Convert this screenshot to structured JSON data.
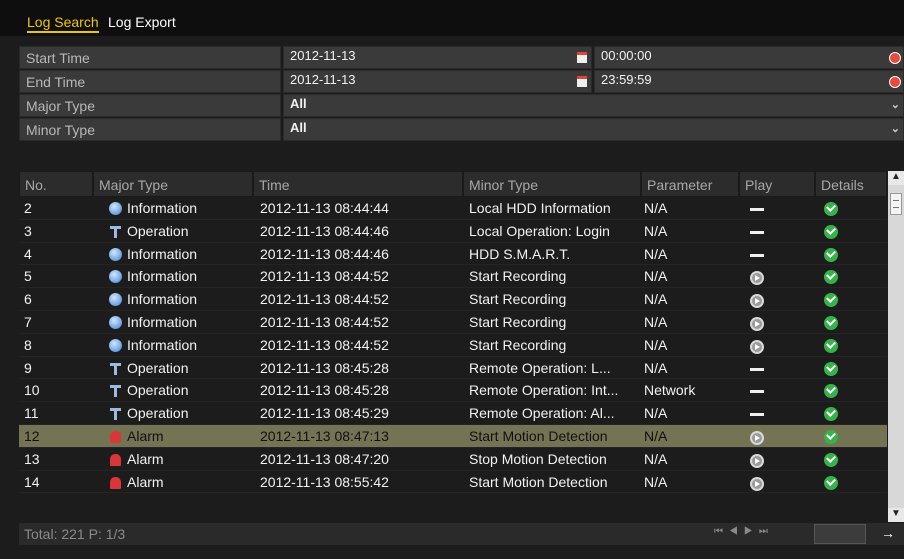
{
  "tabs": [
    {
      "label": "Log Search",
      "active": true
    },
    {
      "label": "Log Export",
      "active": false
    }
  ],
  "filters": {
    "start_time": {
      "label": "Start Time",
      "date": "2012-11-13",
      "time": "00:00:00"
    },
    "end_time": {
      "label": "End Time",
      "date": "2012-11-13",
      "time": "23:59:59"
    },
    "major_type": {
      "label": "Major Type",
      "value": "All"
    },
    "minor_type": {
      "label": "Minor Type",
      "value": "All"
    }
  },
  "table": {
    "columns": [
      "No.",
      "Major Type",
      "Time",
      "Minor Type",
      "Parameter",
      "Play",
      "Details"
    ],
    "rows": [
      {
        "no": "2",
        "major": "Information",
        "major_icon": "info-icon",
        "time": "2012-11-13 08:44:44",
        "minor": "Local HDD Information",
        "param": "N/A",
        "play": "dash",
        "selected": false
      },
      {
        "no": "3",
        "major": "Operation",
        "major_icon": "operation-icon",
        "time": "2012-11-13 08:44:46",
        "minor": "Local Operation: Login",
        "param": "N/A",
        "play": "dash",
        "selected": false
      },
      {
        "no": "4",
        "major": "Information",
        "major_icon": "info-icon",
        "time": "2012-11-13 08:44:46",
        "minor": "HDD S.M.A.R.T.",
        "param": "N/A",
        "play": "dash",
        "selected": false
      },
      {
        "no": "5",
        "major": "Information",
        "major_icon": "info-icon",
        "time": "2012-11-13 08:44:52",
        "minor": "Start Recording",
        "param": "N/A",
        "play": "play",
        "selected": false
      },
      {
        "no": "6",
        "major": "Information",
        "major_icon": "info-icon",
        "time": "2012-11-13 08:44:52",
        "minor": "Start Recording",
        "param": "N/A",
        "play": "play",
        "selected": false
      },
      {
        "no": "7",
        "major": "Information",
        "major_icon": "info-icon",
        "time": "2012-11-13 08:44:52",
        "minor": "Start Recording",
        "param": "N/A",
        "play": "play",
        "selected": false
      },
      {
        "no": "8",
        "major": "Information",
        "major_icon": "info-icon",
        "time": "2012-11-13 08:44:52",
        "minor": "Start Recording",
        "param": "N/A",
        "play": "play",
        "selected": false
      },
      {
        "no": "9",
        "major": "Operation",
        "major_icon": "operation-icon",
        "time": "2012-11-13 08:45:28",
        "minor": "Remote Operation: L...",
        "param": "N/A",
        "play": "dash",
        "selected": false
      },
      {
        "no": "10",
        "major": "Operation",
        "major_icon": "operation-icon",
        "time": "2012-11-13 08:45:28",
        "minor": "Remote Operation: Int...",
        "param": "Network",
        "play": "dash",
        "selected": false
      },
      {
        "no": "11",
        "major": "Operation",
        "major_icon": "operation-icon",
        "time": "2012-11-13 08:45:29",
        "minor": "Remote Operation: Al...",
        "param": "N/A",
        "play": "dash",
        "selected": false
      },
      {
        "no": "12",
        "major": "Alarm",
        "major_icon": "alarm-icon",
        "time": "2012-11-13 08:47:13",
        "minor": "Start Motion Detection",
        "param": "N/A",
        "play": "play",
        "selected": true
      },
      {
        "no": "13",
        "major": "Alarm",
        "major_icon": "alarm-icon",
        "time": "2012-11-13 08:47:20",
        "minor": "Stop Motion Detection",
        "param": "N/A",
        "play": "play",
        "selected": false
      },
      {
        "no": "14",
        "major": "Alarm",
        "major_icon": "alarm-icon",
        "time": "2012-11-13 08:55:42",
        "minor": "Start Motion Detection",
        "param": "N/A",
        "play": "play",
        "selected": false
      }
    ]
  },
  "footer": {
    "total": "Total: 221  P: 1/3"
  }
}
